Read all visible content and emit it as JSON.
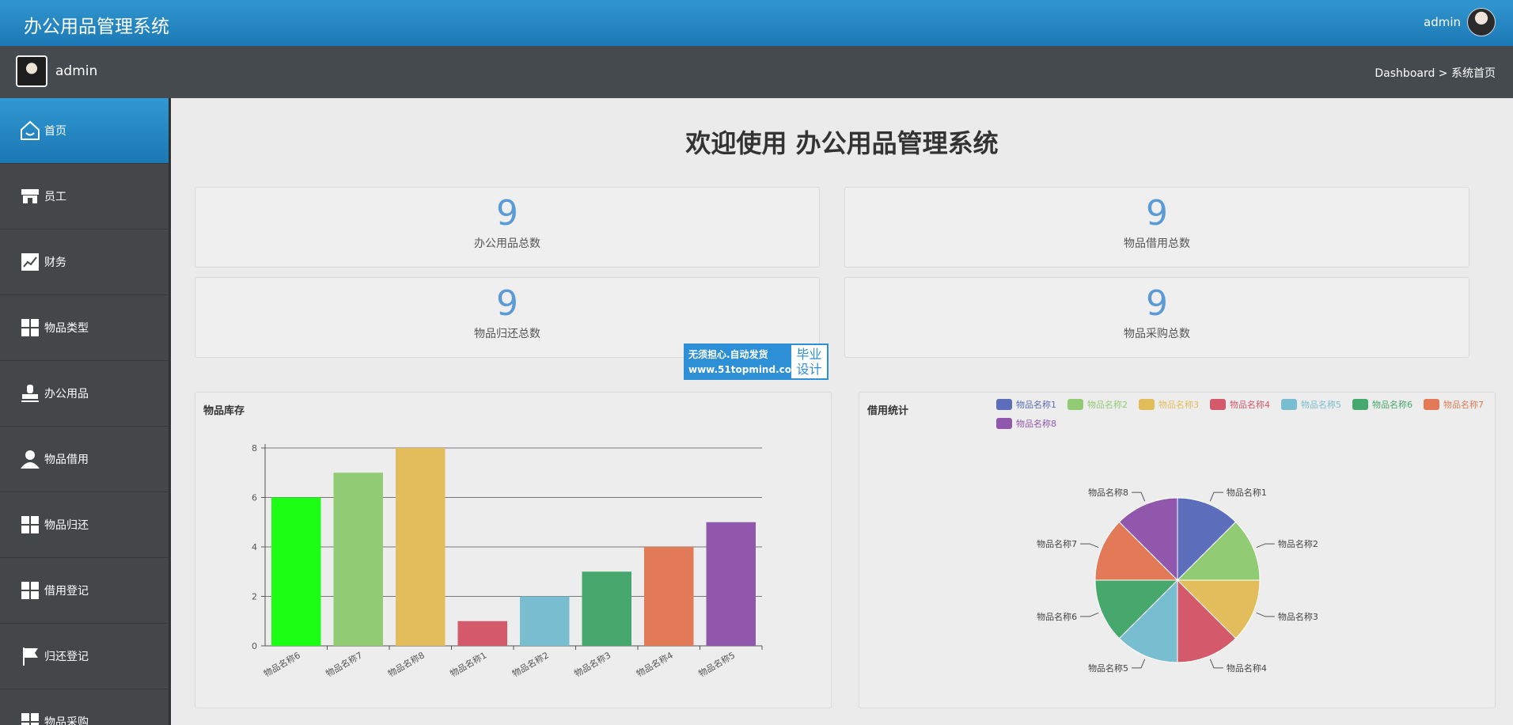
{
  "header": {
    "app_title": "办公用品管理系统",
    "user_name": "admin"
  },
  "userbar": {
    "user_label": "admin",
    "breadcrumb": "Dashboard > 系统首页"
  },
  "sidebar": {
    "items": [
      {
        "label": "首页",
        "icon": "home-icon",
        "active": true
      },
      {
        "label": "员工",
        "icon": "store-icon",
        "active": false
      },
      {
        "label": "财务",
        "icon": "chart-line-icon",
        "active": false
      },
      {
        "label": "物品类型",
        "icon": "grid-icon",
        "active": false
      },
      {
        "label": "办公用品",
        "icon": "stamp-icon",
        "active": false
      },
      {
        "label": "物品借用",
        "icon": "user-icon",
        "active": false
      },
      {
        "label": "物品归还",
        "icon": "grid-icon",
        "active": false
      },
      {
        "label": "借用登记",
        "icon": "grid-icon",
        "active": false
      },
      {
        "label": "归还登记",
        "icon": "flag-icon",
        "active": false
      },
      {
        "label": "物品采购",
        "icon": "grid-icon",
        "active": false
      }
    ]
  },
  "main": {
    "welcome": "欢迎使用 办公用品管理系统",
    "stats": [
      {
        "value": "9",
        "label": "办公用品总数"
      },
      {
        "value": "9",
        "label": "物品借用总数"
      },
      {
        "value": "9",
        "label": "物品归还总数"
      },
      {
        "value": "9",
        "label": "物品采购总数"
      }
    ],
    "watermark": {
      "line1": "无须担心.自动发货",
      "line2": "www.51topmind.com",
      "right1": "毕业",
      "right2": "设计"
    }
  },
  "chart_data": [
    {
      "type": "bar",
      "title": "物品库存",
      "categories": [
        "物品名称6",
        "物品名称7",
        "物品名称8",
        "物品名称1",
        "物品名称2",
        "物品名称3",
        "物品名称4",
        "物品名称5"
      ],
      "values": [
        6,
        7,
        8,
        1,
        2,
        3,
        4,
        5
      ],
      "colors": [
        "#1cff15",
        "#91cc75",
        "#e3bd5b",
        "#d4596a",
        "#79bdd0",
        "#46a86d",
        "#e27a57",
        "#9157ad"
      ],
      "ylim": [
        0,
        8
      ],
      "yticks": [
        0,
        2,
        4,
        6,
        8
      ],
      "grid": true
    },
    {
      "type": "pie",
      "title": "借用统计",
      "labels": [
        "物品名称1",
        "物品名称2",
        "物品名称3",
        "物品名称4",
        "物品名称5",
        "物品名称6",
        "物品名称7",
        "物品名称8"
      ],
      "values": [
        1,
        1,
        1,
        1,
        1,
        1,
        1,
        1
      ],
      "colors": [
        "#5b6dbb",
        "#91cc75",
        "#e3bd5b",
        "#d4596a",
        "#79bdd0",
        "#46a86d",
        "#e27a57",
        "#9157ad"
      ],
      "legend": "top-right"
    }
  ]
}
